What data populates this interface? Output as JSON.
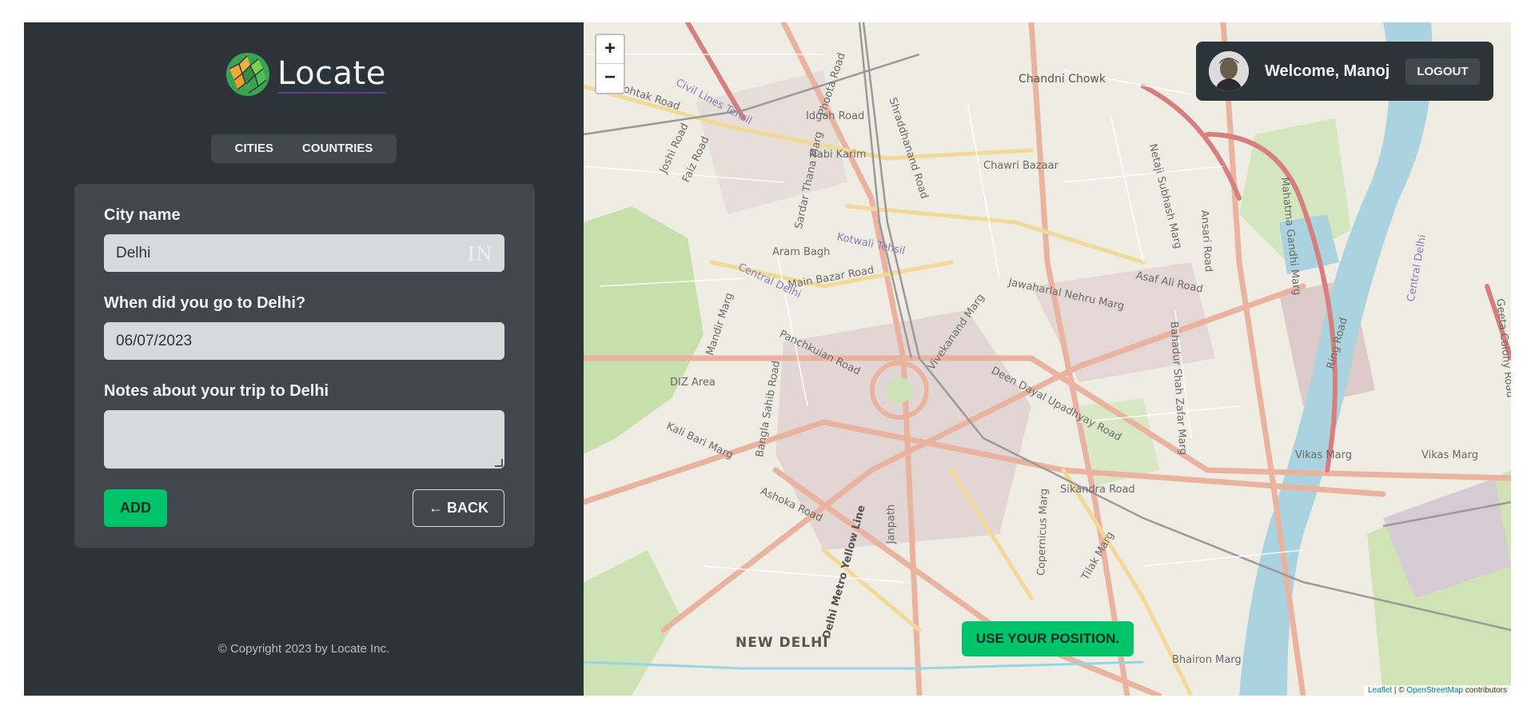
{
  "app": {
    "name": "Locate"
  },
  "nav": {
    "tabs": [
      "CITIES",
      "COUNTRIES"
    ]
  },
  "form": {
    "city_label": "City name",
    "city_value": "Delhi",
    "country_code": "IN",
    "date_label": "When did you go to Delhi?",
    "date_value": "06/07/2023",
    "notes_label": "Notes about your trip to Delhi",
    "notes_value": "",
    "add_label": "ADD",
    "back_label": "← BACK"
  },
  "footer": {
    "text": "© Copyright 2023 by Locate Inc."
  },
  "user": {
    "welcome": "Welcome, Manoj",
    "logout_label": "LOGOUT"
  },
  "map": {
    "zoom_in": "+",
    "zoom_out": "−",
    "use_position_label": "USE YOUR POSITION.",
    "attribution_leaflet": "Leaflet",
    "attribution_sep": " | © ",
    "attribution_osm": "OpenStreetMap",
    "attribution_tail": " contributors",
    "labels": {
      "chandni_chowk": "Chandni Chowk",
      "idgah_road": "Idgah Road",
      "nabi_karim": "Nabi Karim",
      "chawri_bazaar": "Chawri Bazaar",
      "aram_bagh": "Aram Bagh",
      "main_bazar_road": "Main Bazar Road",
      "asaf_ali_road": "Asaf Ali Road",
      "jawaharlal_nehru_marg": "Jawaharlal Nehru Marg",
      "diz_area": "DIZ Area",
      "deen_dayal": "Deen Dayal Upadhyay Road",
      "sikandra_road": "Sikandra Road",
      "new_delhi": "NEW DELHI",
      "vikas_marg": "Vikas Marg",
      "vikas_marg_2": "Vikas Marg",
      "bhairon_marg": "Bhairon Marg",
      "ashoka_road": "Ashoka Road",
      "janpath": "Janpath",
      "copernicus_marg": "Copernicus Marg",
      "tilak_marg": "Tilak Marg",
      "panchkuian_road": "Panchkuian Road",
      "bangla_sahib_road": "Bangla Sahib Road",
      "mandir_marg": "Mandir Marg",
      "kali_bari_marg": "Kali Bari Marg",
      "rohtak_road": "Rohtak Road",
      "ring_road": "Ring Road",
      "mahatma_gandhi_marg": "Mahatma Gandhi Marg",
      "bahadur_shah_zafar_marg": "Bahadur Shah Zafar Marg",
      "netaji_subhash_marg": "Netaji Subhash Marg",
      "shraddhanand_road": "Shraddhanand Road",
      "central_delhi": "Central Delhi",
      "delhi_metro_yellow_line": "Delhi Metro Yellow Line",
      "vivekanand_marg": "Vivekanand Marg",
      "kotwali_tehsil": "Kotwali Tehsil",
      "phoota_road": "Phoota Road",
      "sardar_thana_marg": "Sardar Thana Marg",
      "civil_lines_tehsil": "Civil Lines Tehsil",
      "joshi_road": "Joshi Road",
      "faiz_road": "Faiz Road",
      "ansari_road": "Ansari Road",
      "central_delhi_v": "Central Delhi",
      "geeta_colony_road": "Geeta Colony Road"
    }
  },
  "colors": {
    "sidebar_bg": "#2d3439",
    "panel_bg": "#42474d",
    "accent": "#00c46a",
    "input_bg": "#d5dbdc"
  },
  "icons": {
    "logo": "globe-logo-icon",
    "resize": "resize-handle-icon"
  }
}
